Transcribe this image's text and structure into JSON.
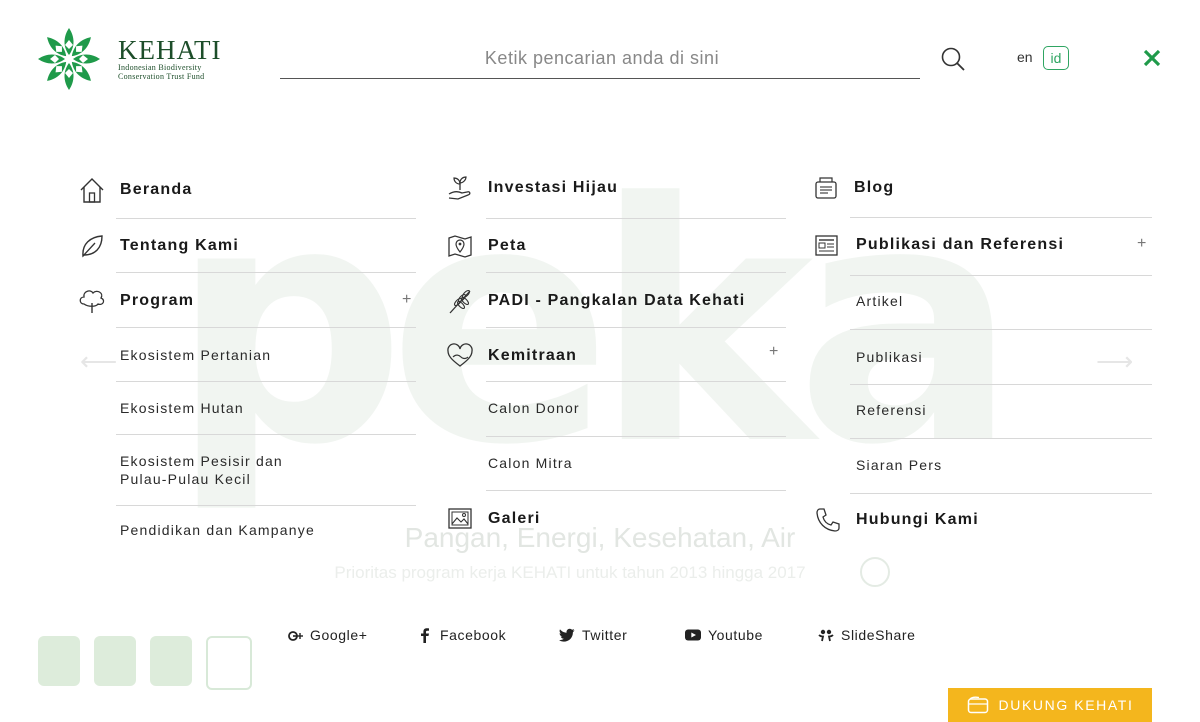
{
  "brand": {
    "name": "KEHATI",
    "subtitle_line1": "Indonesian Biodiversity",
    "subtitle_line2": "Conservation Trust Fund",
    "accent_color": "#2fa562",
    "donate_color": "#f4b61d"
  },
  "search": {
    "placeholder": "Ketik pencarian anda di sini",
    "value": ""
  },
  "languages": {
    "en": "en",
    "id": "id",
    "active": "id"
  },
  "menu": {
    "col1": {
      "items": [
        {
          "label": "Beranda",
          "icon": "home-icon"
        },
        {
          "label": "Tentang Kami",
          "icon": "leaf-icon"
        },
        {
          "label": "Program",
          "icon": "tree-icon",
          "expand": "+"
        }
      ],
      "sub": [
        "Ekosistem Pertanian",
        "Ekosistem Hutan",
        "Ekosistem Pesisir dan",
        "Pulau-Pulau Kecil",
        "Pendidikan dan Kampanye"
      ]
    },
    "col2": {
      "items": [
        {
          "label": "Investasi Hijau",
          "icon": "plant-hand-icon"
        },
        {
          "label": "Peta",
          "icon": "map-pin-icon"
        },
        {
          "label": "PADI - Pangkalan Data Kehati",
          "icon": "wheat-icon"
        },
        {
          "label": "Kemitraan",
          "icon": "heart-hands-icon",
          "expand": "+"
        },
        {
          "label": "Galeri",
          "icon": "image-icon"
        }
      ],
      "sub": [
        "Calon Donor",
        "Calon Mitra"
      ]
    },
    "col3": {
      "items": [
        {
          "label": "Blog",
          "icon": "blog-icon"
        },
        {
          "label": "Publikasi dan Referensi",
          "icon": "newspaper-icon",
          "expand": "+"
        },
        {
          "label": "Hubungi Kami",
          "icon": "phone-icon"
        }
      ],
      "sub": [
        "Artikel",
        "Publikasi",
        "Referensi",
        "Siaran Pers"
      ]
    }
  },
  "background": {
    "letters": "peka",
    "tagline": "Pangan, Energi, Kesehatan, Air",
    "subtagline": "Prioritas program kerja KEHATI untuk tahun 2013 hingga 2017"
  },
  "social": [
    {
      "label": "Google+",
      "icon": "google-plus-icon"
    },
    {
      "label": "Facebook",
      "icon": "facebook-icon"
    },
    {
      "label": "Twitter",
      "icon": "twitter-icon"
    },
    {
      "label": "Youtube",
      "icon": "youtube-icon"
    },
    {
      "label": "SlideShare",
      "icon": "slideshare-icon"
    }
  ],
  "donate": {
    "label": "DUKUNG KEHATI",
    "icon": "wallet-icon"
  }
}
